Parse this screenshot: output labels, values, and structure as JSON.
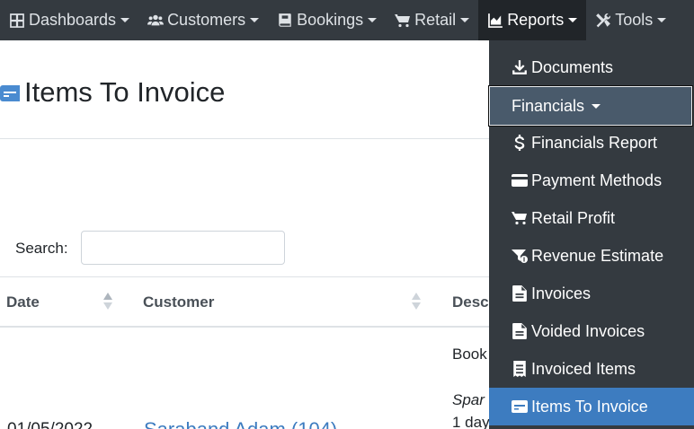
{
  "nav": {
    "items": [
      {
        "label": "Dashboards",
        "icon": "grid-icon"
      },
      {
        "label": "Customers",
        "icon": "users-icon"
      },
      {
        "label": "Bookings",
        "icon": "book-icon"
      },
      {
        "label": "Retail",
        "icon": "cart-icon"
      },
      {
        "label": "Reports",
        "icon": "chart-area-icon"
      },
      {
        "label": "Tools",
        "icon": "tools-icon"
      }
    ],
    "active": "Reports"
  },
  "page": {
    "title": "Items To Invoice",
    "title_icon": "money-card-icon"
  },
  "search": {
    "label": "Search:",
    "value": ""
  },
  "table": {
    "columns": [
      "Date",
      "Customer",
      "Desc"
    ],
    "row": {
      "line1": "Book",
      "line2": "Spar",
      "line3": "1 day",
      "date": "01/05/2022",
      "customer": "Saraband Adam (104)"
    }
  },
  "dropdown": {
    "items": [
      {
        "label": "Documents",
        "icon": "download-icon"
      },
      {
        "label": "Financials",
        "icon": "",
        "group": true
      },
      {
        "label": "Financials Report",
        "icon": "dollar-icon"
      },
      {
        "label": "Payment Methods",
        "icon": "credit-card-icon"
      },
      {
        "label": "Retail Profit",
        "icon": "cart-icon"
      },
      {
        "label": "Revenue Estimate",
        "icon": "filter-dollar-icon"
      },
      {
        "label": "Invoices",
        "icon": "file-text-icon"
      },
      {
        "label": "Voided Invoices",
        "icon": "file-text-icon"
      },
      {
        "label": "Invoiced Items",
        "icon": "receipt-icon"
      },
      {
        "label": "Items To Invoice",
        "icon": "money-card-icon",
        "selected": true
      }
    ]
  },
  "colors": {
    "navbar": "#343a40",
    "active_nav": "#212529",
    "dropdown_bg": "#343a40",
    "selected_item": "#3d7cc0",
    "link": "#3d7cc0"
  }
}
